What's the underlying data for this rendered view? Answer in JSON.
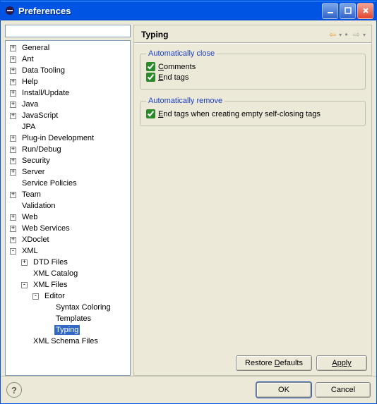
{
  "window": {
    "title": "Preferences",
    "buttons": {
      "minimize": "minimize",
      "maximize": "maximize",
      "close": "close"
    }
  },
  "filter": {
    "placeholder": ""
  },
  "tree": [
    {
      "level": 0,
      "expander": "+",
      "label": "General"
    },
    {
      "level": 0,
      "expander": "+",
      "label": "Ant"
    },
    {
      "level": 0,
      "expander": "+",
      "label": "Data Tooling"
    },
    {
      "level": 0,
      "expander": "+",
      "label": "Help"
    },
    {
      "level": 0,
      "expander": "+",
      "label": "Install/Update"
    },
    {
      "level": 0,
      "expander": "+",
      "label": "Java"
    },
    {
      "level": 0,
      "expander": "+",
      "label": "JavaScript"
    },
    {
      "level": 0,
      "expander": "",
      "label": "JPA"
    },
    {
      "level": 0,
      "expander": "+",
      "label": "Plug-in Development"
    },
    {
      "level": 0,
      "expander": "+",
      "label": "Run/Debug"
    },
    {
      "level": 0,
      "expander": "+",
      "label": "Security"
    },
    {
      "level": 0,
      "expander": "+",
      "label": "Server"
    },
    {
      "level": 0,
      "expander": "",
      "label": "Service Policies"
    },
    {
      "level": 0,
      "expander": "+",
      "label": "Team"
    },
    {
      "level": 0,
      "expander": "",
      "label": "Validation"
    },
    {
      "level": 0,
      "expander": "+",
      "label": "Web"
    },
    {
      "level": 0,
      "expander": "+",
      "label": "Web Services"
    },
    {
      "level": 0,
      "expander": "+",
      "label": "XDoclet"
    },
    {
      "level": 0,
      "expander": "-",
      "label": "XML"
    },
    {
      "level": 1,
      "expander": "+",
      "label": "DTD Files"
    },
    {
      "level": 1,
      "expander": "",
      "label": "XML Catalog"
    },
    {
      "level": 1,
      "expander": "-",
      "label": "XML Files"
    },
    {
      "level": 2,
      "expander": "-",
      "label": "Editor"
    },
    {
      "level": 3,
      "expander": "",
      "label": "Syntax Coloring"
    },
    {
      "level": 3,
      "expander": "",
      "label": "Templates"
    },
    {
      "level": 3,
      "expander": "",
      "label": "Typing",
      "selected": true
    },
    {
      "level": 1,
      "expander": "",
      "label": "XML Schema Files"
    }
  ],
  "page": {
    "title": "Typing",
    "groups": {
      "close": {
        "legend": "Automatically close",
        "comments_mn": "C",
        "comments_rest": "omments",
        "comments_checked": true,
        "endtags_mn": "E",
        "endtags_rest": "nd tags",
        "endtags_checked": true
      },
      "remove": {
        "legend": "Automatically remove",
        "self_mn": "E",
        "self_rest": "nd tags when creating empty self-closing tags",
        "self_checked": true
      }
    }
  },
  "buttons": {
    "restore_mn": "D",
    "restore_pre": "Restore ",
    "restore_post": "efaults",
    "apply": "Apply",
    "ok": "OK",
    "cancel": "Cancel"
  }
}
